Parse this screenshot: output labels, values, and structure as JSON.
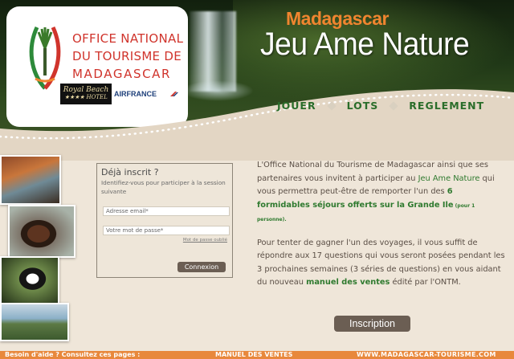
{
  "header": {
    "org_lines": [
      "OFFICE NATIONAL",
      "DU TOURISME DE",
      "MADAGASCAR"
    ],
    "partner_royal_beach": [
      "Royal Beach",
      "★★★★ HOTEL"
    ],
    "partner_airfrance": "AIRFRANCE",
    "brand_sub": "Madagascar",
    "brand_main": "Jeu Ame Nature"
  },
  "nav": {
    "items": [
      {
        "label": "JOUER"
      },
      {
        "label": "LOTS"
      },
      {
        "label": "REGLEMENT"
      }
    ]
  },
  "login": {
    "title": "Déjà inscrit ?",
    "subtitle": "Identifiez-vous pour participer à la session suivante",
    "email_placeholder": "Adresse email*",
    "password_placeholder": "Votre mot de passe*",
    "forgot": "Mot de passe oublié",
    "submit": "Connexion"
  },
  "info": {
    "p1_a": "L'Office National du Tourisme de Madagascar ainsi que ses partenaires vous invitent à participer au ",
    "p1_link": "Jeu Ame Nature",
    "p1_b": " qui vous permettra peut-être de remporter l'un des ",
    "p1_bold": "6 formidables séjours offerts sur la Grande Ile",
    "p1_small": " (pour 1 personne).",
    "p2_a": "Pour tenter de gagner l'un des voyages, il vous suffit de répondre aux 17 questions qui vous seront posées pendant les 3 prochaines semaines (3 séries de questions) en vous aidant du nouveau ",
    "p2_link": "manuel des ventes",
    "p2_b": " édité par l'ONTM."
  },
  "cta": {
    "inscription": "Inscription"
  },
  "footer": {
    "help": "Besoin d'aide ? Consultez ces pages :",
    "manual": "MANUEL DES VENTES",
    "site": "WWW.MADAGASCAR-TOURISME.COM"
  },
  "colors": {
    "accent_orange": "#e8883c",
    "nav_green": "#2a6d2a",
    "text_brown": "#5a4e45",
    "button_brown": "#6b5e53",
    "logo_red": "#d0342c"
  },
  "icons": [
    "traveller-tree-emblem-icon",
    "airfrance-logo-icon",
    "nav-diamond-icon"
  ]
}
